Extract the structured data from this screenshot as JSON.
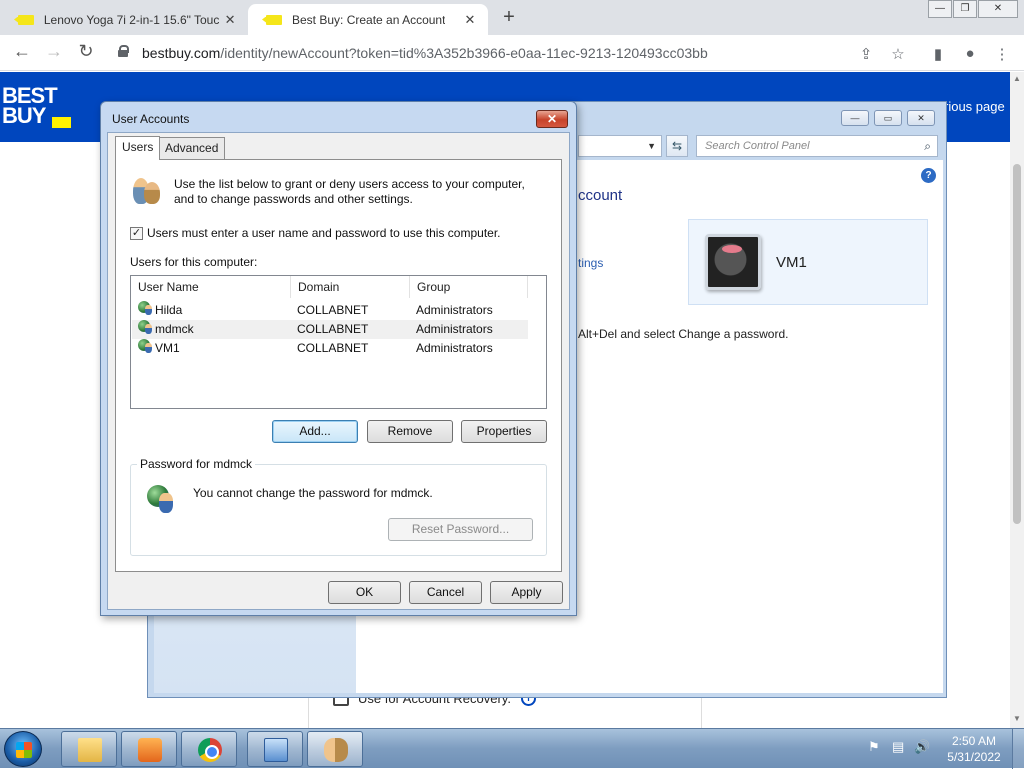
{
  "browser": {
    "tabs": [
      {
        "title": "Lenovo Yoga 7i 2-in-1 15.6\" Touc",
        "close": "✕"
      },
      {
        "title": "Best Buy: Create an Account",
        "close": "✕"
      }
    ],
    "new_tab": "+",
    "url_host": "bestbuy.com",
    "url_rest": "/identity/newAccount?token=tid%3A352b3966-e0aa-11ec-9213-120493cc03bb",
    "back": "←",
    "forward": "→",
    "reload": "↻",
    "window_controls": [
      "—",
      "❐",
      "✕"
    ]
  },
  "page": {
    "logo_line1": "BEST",
    "logo_line2": "BUY",
    "prev_link": "rious page",
    "recovery_label": "Use for Account Recovery.",
    "info_icon": "i",
    "colors": {
      "brand_blue": "#0046be",
      "brand_yellow": "#fff200"
    }
  },
  "control_panel": {
    "window_controls": [
      "—",
      "▭",
      "✕"
    ],
    "dropdown_arrow": "▼",
    "refresh_icon": "⇆",
    "search_placeholder": "Search Control Panel",
    "search_icon": "⌕",
    "help_icon": "?",
    "heading": "ccount",
    "link": "tings",
    "user_name": "VM1",
    "text": "Alt+Del and select Change a password."
  },
  "dialog": {
    "title": "User Accounts",
    "close": "✕",
    "tabs": [
      "Users",
      "Advanced"
    ],
    "intro": "Use the list below to grant or deny users access to your computer, and to change passwords and other settings.",
    "checkbox_mark": "✓",
    "checkbox_label": "Users must enter a user name and password to use this computer.",
    "users_label": "Users for this computer:",
    "columns": [
      "User Name",
      "Domain",
      "Group"
    ],
    "rows": [
      {
        "name": "Hilda",
        "domain": "COLLABNET",
        "group": "Administrators"
      },
      {
        "name": "mdmck",
        "domain": "COLLABNET",
        "group": "Administrators"
      },
      {
        "name": "VM1",
        "domain": "COLLABNET",
        "group": "Administrators"
      }
    ],
    "buttons": {
      "add": "Add...",
      "remove": "Remove",
      "properties": "Properties"
    },
    "password_group_title": "Password for mdmck",
    "password_text": "You cannot change the password for mdmck.",
    "reset_password": "Reset Password...",
    "footer": {
      "ok": "OK",
      "cancel": "Cancel",
      "apply": "Apply"
    }
  },
  "taskbar": {
    "time": "2:50 AM",
    "date": "5/31/2022",
    "tray_icons": [
      "⚑",
      "▤",
      "🔊"
    ]
  }
}
